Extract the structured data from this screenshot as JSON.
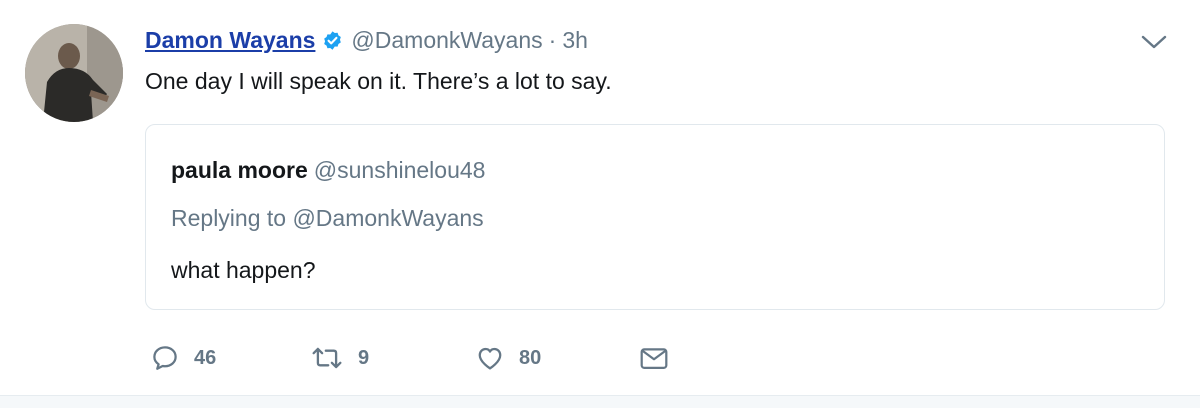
{
  "tweet": {
    "author_name": "Damon Wayans",
    "author_handle": "@DamonkWayans",
    "separator": "·",
    "time": "3h",
    "text": "One day I will speak on it. There’s a lot to say.",
    "icons": {
      "verified": "verified-badge-icon",
      "menu": "chevron-down-icon"
    },
    "colors": {
      "name": "#1b3ea8",
      "verified": "#1da1f2",
      "muted": "#657786"
    }
  },
  "quote": {
    "name": "paula moore",
    "handle": "@sunshinelou48",
    "replying_to": "Replying to @DamonkWayans",
    "text": "what happen?"
  },
  "actions": {
    "reply_count": "46",
    "retweet_count": "9",
    "like_count": "80",
    "icons": [
      "reply-icon",
      "retweet-icon",
      "like-icon",
      "message-icon"
    ]
  }
}
